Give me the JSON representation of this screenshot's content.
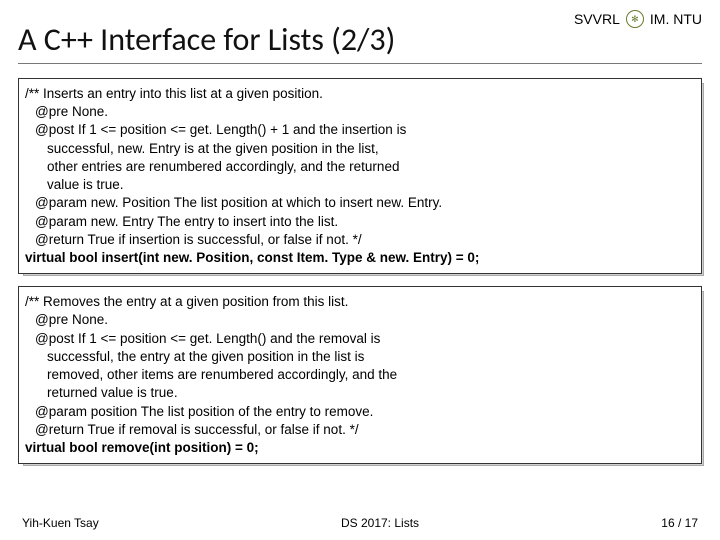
{
  "header": {
    "org_left": "SVVRL",
    "org_right": "IM. NTU",
    "title": "A C++ Interface for Lists (2/3)"
  },
  "box1": {
    "l1": "/** Inserts an entry into this list at a given position.",
    "l2": "@pre None.",
    "l3": "@post If 1 <= position <= get. Length() + 1 and the insertion is",
    "l4": "successful, new. Entry is at the given position in the list,",
    "l5": "other entries are renumbered accordingly, and the returned",
    "l6": "value is true.",
    "l7": "@param new. Position The list position at which to insert new. Entry.",
    "l8": "@param new. Entry The entry to insert into the list.",
    "l9": "@return True if insertion is successful, or false if not. */",
    "sig": "virtual bool insert(int new. Position, const Item. Type & new. Entry) = 0;"
  },
  "box2": {
    "l1": "/** Removes the entry at a given position from this list.",
    "l2": "@pre None.",
    "l3": "@post If 1 <= position <= get. Length() and the removal is",
    "l4": "successful, the entry at the given position in the list is",
    "l5": "removed, other items are renumbered accordingly, and the",
    "l6": "returned value is true.",
    "l7": "@param position The list position of the entry to remove.",
    "l8": "@return True if removal is successful, or false if not. */",
    "sig": "virtual bool remove(int position) = 0;"
  },
  "footer": {
    "author": "Yih-Kuen Tsay",
    "course": "DS 2017: Lists",
    "page": "16 / 17"
  }
}
